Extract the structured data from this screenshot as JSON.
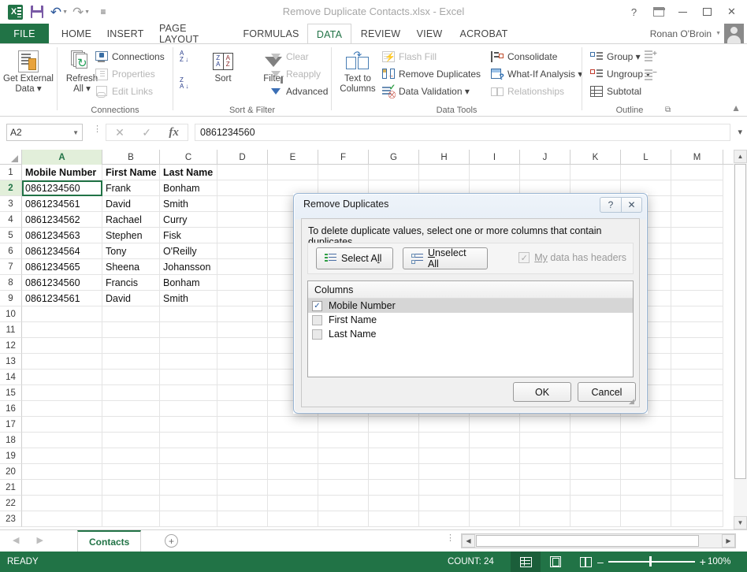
{
  "titlebar": {
    "document_title": "Remove Duplicate Contacts.xlsx - Excel",
    "qat": [
      {
        "name": "excel-logo-icon",
        "label": "X"
      },
      {
        "name": "save-icon",
        "label": "Save"
      },
      {
        "name": "undo-icon",
        "label": "Undo"
      },
      {
        "name": "redo-icon",
        "label": "Redo"
      },
      {
        "name": "customize-qat-icon",
        "label": "Customize Quick Access Toolbar"
      }
    ],
    "window_buttons": {
      "help": "?",
      "ribbon_display": "Ribbon Display Options",
      "minimize": "–",
      "restore": "Restore",
      "close": "✕"
    }
  },
  "tabs": {
    "file": "FILE",
    "items": [
      "HOME",
      "INSERT",
      "PAGE LAYOUT",
      "FORMULAS",
      "DATA",
      "REVIEW",
      "VIEW",
      "ACROBAT"
    ],
    "active": "DATA",
    "user": "Ronan O'Broin"
  },
  "ribbon": {
    "groups": [
      {
        "name": "get-external-data",
        "label": "",
        "big_buttons": [
          {
            "label": "Get External\nData",
            "line1": "Get External",
            "line2": "Data ▾"
          }
        ]
      },
      {
        "name": "connections",
        "label": "Connections",
        "big_buttons": [
          {
            "line1": "Refresh",
            "line2": "All ▾"
          }
        ],
        "small_buttons": [
          {
            "label": "Connections",
            "disabled": false
          },
          {
            "label": "Properties",
            "disabled": true
          },
          {
            "label": "Edit Links",
            "disabled": true
          }
        ]
      },
      {
        "name": "sort-and-filter",
        "label": "Sort & Filter",
        "big_buttons": [
          {
            "line1": "Sort"
          },
          {
            "line1": "Filter"
          }
        ],
        "small_buttons": [
          {
            "label": "Clear",
            "disabled": true
          },
          {
            "label": "Reapply",
            "disabled": true
          },
          {
            "label": "Advanced",
            "disabled": false
          }
        ]
      },
      {
        "name": "data-tools",
        "label": "Data Tools",
        "big_buttons": [
          {
            "line1": "Text to",
            "line2": "Columns"
          }
        ],
        "small_buttons": [
          {
            "label": "Flash Fill",
            "disabled": true
          },
          {
            "label": "Remove Duplicates",
            "disabled": false
          },
          {
            "label": "Data Validation  ▾",
            "disabled": false
          },
          {
            "label": "Consolidate",
            "disabled": false
          },
          {
            "label": "What-If Analysis ▾",
            "disabled": false
          },
          {
            "label": "Relationships",
            "disabled": true
          }
        ]
      },
      {
        "name": "outline",
        "label": "Outline",
        "small_buttons": [
          {
            "label": "Group   ▾",
            "disabled": false
          },
          {
            "label": "Ungroup  ▾",
            "disabled": false
          },
          {
            "label": "Subtotal",
            "disabled": false
          }
        ]
      }
    ],
    "collapse_label": "▲"
  },
  "formula_bar": {
    "name_box_value": "A2",
    "cancel_icon": "✕",
    "enter_icon": "✓",
    "function_icon": "fx",
    "formula_value": "0861234560",
    "expand_icon": "▾"
  },
  "grid": {
    "columns": [
      "A",
      "B",
      "C",
      "D",
      "E",
      "F",
      "G",
      "H",
      "I",
      "J",
      "K",
      "L",
      "M"
    ],
    "selected_column": "A",
    "selected_row": 2,
    "rows": [
      1,
      2,
      3,
      4,
      5,
      6,
      7,
      8,
      9,
      10,
      11,
      12,
      13,
      14,
      15,
      16,
      17,
      18,
      19,
      20,
      21,
      22,
      23
    ],
    "headers": [
      "Mobile Number",
      "First Name",
      "Last Name"
    ],
    "data": [
      [
        "0861234560",
        "Frank",
        "Bonham"
      ],
      [
        "0861234561",
        "David",
        "Smith"
      ],
      [
        "0861234562",
        "Rachael",
        "Curry"
      ],
      [
        "0861234563",
        "Stephen",
        "Fisk"
      ],
      [
        "0861234564",
        "Tony",
        "O'Reilly"
      ],
      [
        "0861234565",
        "Sheena",
        "Johansson"
      ],
      [
        "0861234560",
        "Francis",
        "Bonham"
      ],
      [
        "0861234561",
        "David",
        "Smith"
      ]
    ]
  },
  "dialog": {
    "title": "Remove Duplicates",
    "help_icon": "?",
    "close_icon": "✕",
    "instruction": "To delete duplicate values, select one or more columns that contain duplicates.",
    "select_all_label": "Select All",
    "unselect_all_label": "Unselect All",
    "headers_checkbox_label": "My data has headers",
    "headers_checkbox_checked": true,
    "columns_header": "Columns",
    "columns": [
      {
        "label": "Mobile Number",
        "checked": true,
        "selected": true
      },
      {
        "label": "First Name",
        "checked": false,
        "selected": false
      },
      {
        "label": "Last Name",
        "checked": false,
        "selected": false
      }
    ],
    "ok_label": "OK",
    "cancel_label": "Cancel"
  },
  "sheetbar": {
    "prev_icon": "◀",
    "next_icon": "▶",
    "tabs": [
      "Contacts"
    ],
    "active_tab": "Contacts",
    "add_sheet_icon": "+"
  },
  "statusbar": {
    "ready_text": "READY",
    "count_text": "COUNT: 24",
    "views": [
      "normal-view",
      "page-layout-view",
      "page-break-view"
    ],
    "active_view": "normal-view",
    "zoom_minus": "–",
    "zoom_plus": "+",
    "zoom_percent": "100%"
  },
  "colors": {
    "excel_green": "#217346",
    "tab_active_text": "#217346",
    "selection_outline": "#217346",
    "dialog_border": "#9ab6d4"
  }
}
